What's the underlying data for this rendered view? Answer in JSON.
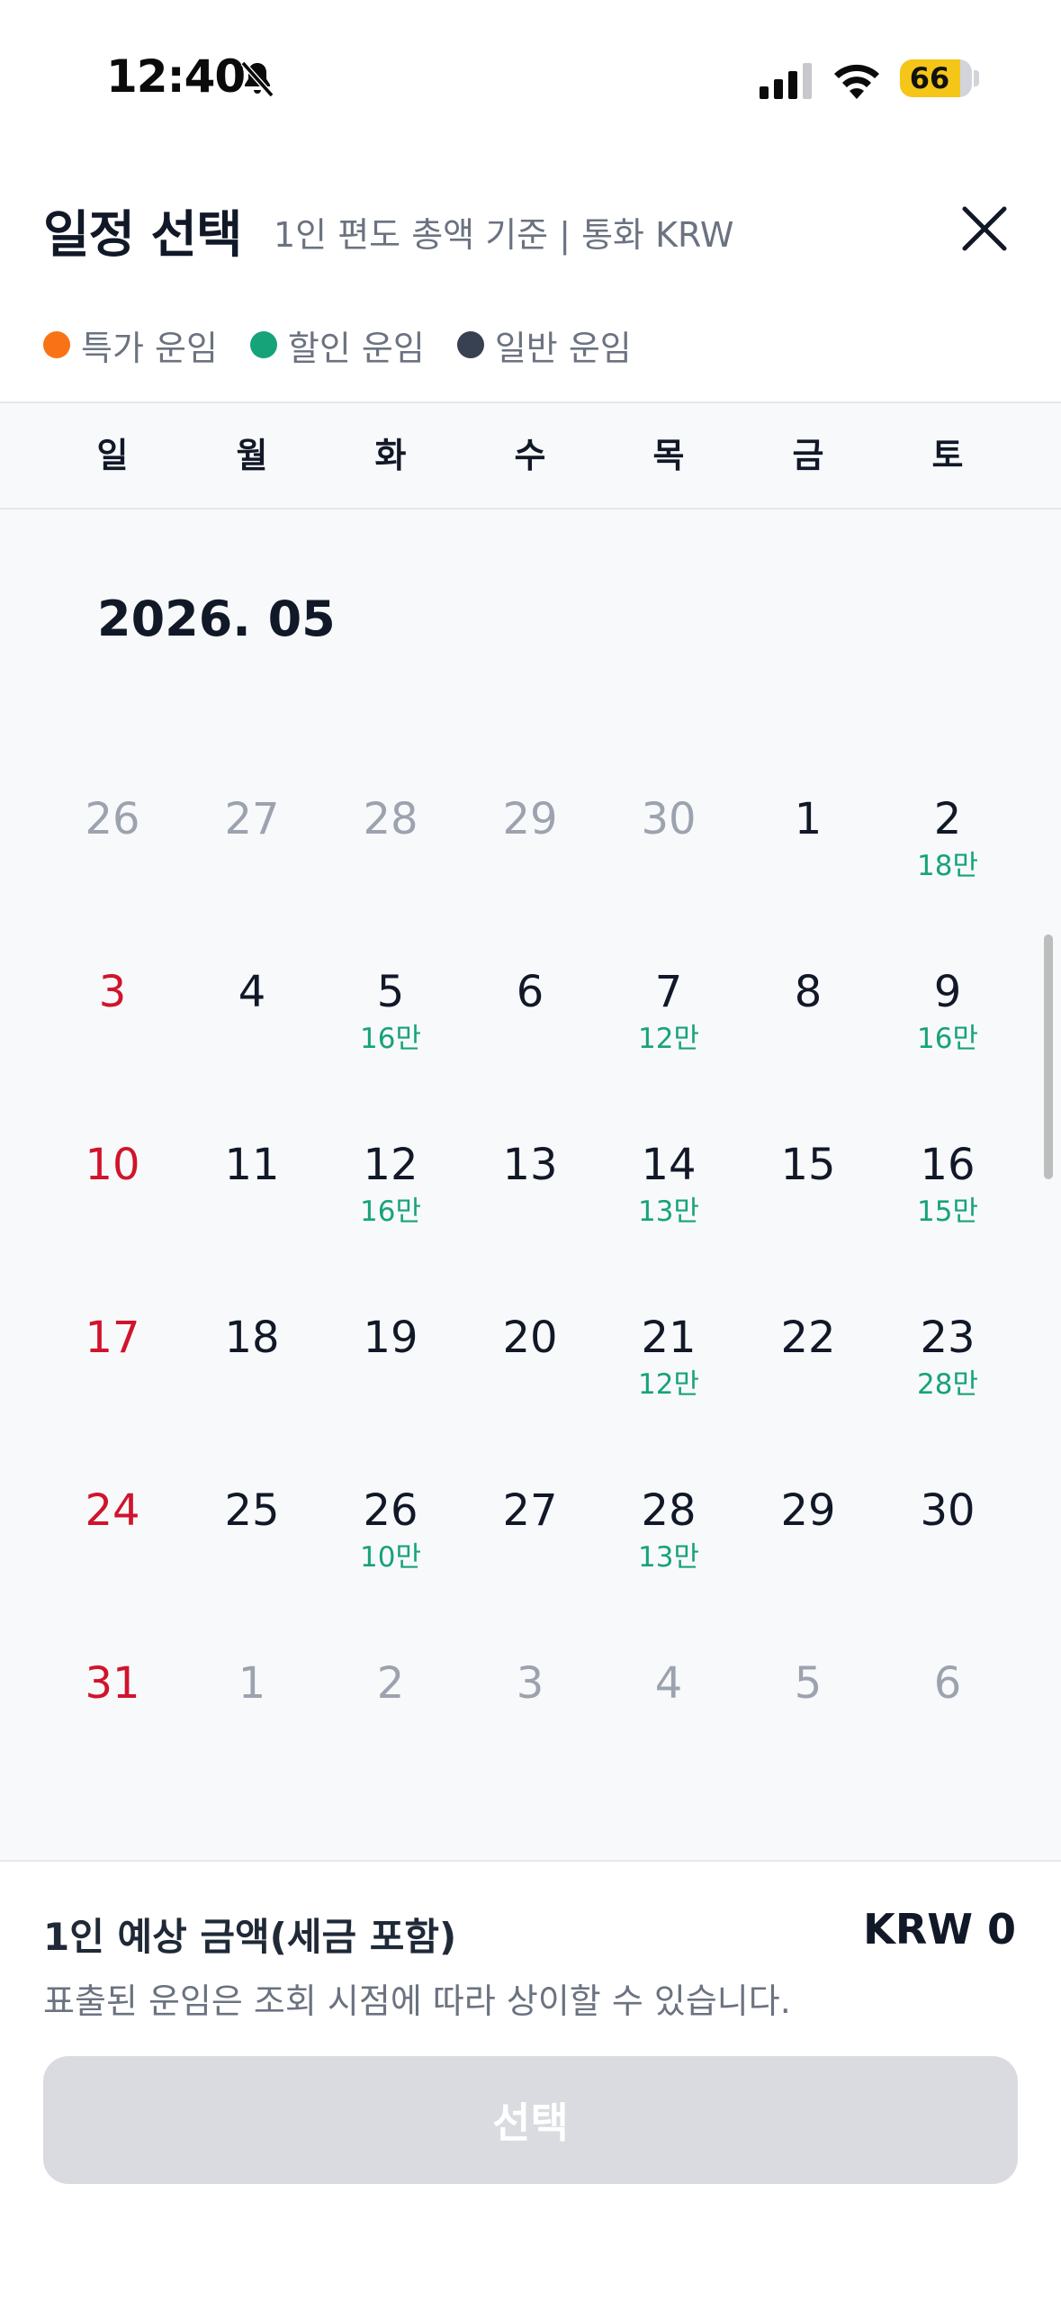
{
  "status_bar": {
    "time": "12:40",
    "battery": "66"
  },
  "header": {
    "title": "일정 선택",
    "subtitle": "1인 편도 총액 기준 | 통화 KRW"
  },
  "legend": [
    {
      "label": "특가 운임",
      "color": "#f97316"
    },
    {
      "label": "할인 운임",
      "color": "#16a37a"
    },
    {
      "label": "일반 운임",
      "color": "#374151"
    }
  ],
  "weekdays": [
    "일",
    "월",
    "화",
    "수",
    "목",
    "금",
    "토"
  ],
  "calendar": {
    "month_label": "2026. 05",
    "weeks": [
      [
        {
          "day": "26",
          "price": "",
          "outside": true
        },
        {
          "day": "27",
          "price": "",
          "outside": true
        },
        {
          "day": "28",
          "price": "",
          "outside": true
        },
        {
          "day": "29",
          "price": "",
          "outside": true
        },
        {
          "day": "30",
          "price": "",
          "outside": true
        },
        {
          "day": "1",
          "price": "",
          "outside": false
        },
        {
          "day": "2",
          "price": "18만",
          "outside": false
        }
      ],
      [
        {
          "day": "3",
          "price": "",
          "outside": false
        },
        {
          "day": "4",
          "price": "",
          "outside": false
        },
        {
          "day": "5",
          "price": "16만",
          "outside": false
        },
        {
          "day": "6",
          "price": "",
          "outside": false
        },
        {
          "day": "7",
          "price": "12만",
          "outside": false
        },
        {
          "day": "8",
          "price": "",
          "outside": false
        },
        {
          "day": "9",
          "price": "16만",
          "outside": false
        }
      ],
      [
        {
          "day": "10",
          "price": "",
          "outside": false
        },
        {
          "day": "11",
          "price": "",
          "outside": false
        },
        {
          "day": "12",
          "price": "16만",
          "outside": false
        },
        {
          "day": "13",
          "price": "",
          "outside": false
        },
        {
          "day": "14",
          "price": "13만",
          "outside": false
        },
        {
          "day": "15",
          "price": "",
          "outside": false
        },
        {
          "day": "16",
          "price": "15만",
          "outside": false
        }
      ],
      [
        {
          "day": "17",
          "price": "",
          "outside": false
        },
        {
          "day": "18",
          "price": "",
          "outside": false
        },
        {
          "day": "19",
          "price": "",
          "outside": false
        },
        {
          "day": "20",
          "price": "",
          "outside": false
        },
        {
          "day": "21",
          "price": "12만",
          "outside": false
        },
        {
          "day": "22",
          "price": "",
          "outside": false
        },
        {
          "day": "23",
          "price": "28만",
          "outside": false
        }
      ],
      [
        {
          "day": "24",
          "price": "",
          "outside": false
        },
        {
          "day": "25",
          "price": "",
          "outside": false
        },
        {
          "day": "26",
          "price": "10만",
          "outside": false
        },
        {
          "day": "27",
          "price": "",
          "outside": false
        },
        {
          "day": "28",
          "price": "13만",
          "outside": false
        },
        {
          "day": "29",
          "price": "",
          "outside": false
        },
        {
          "day": "30",
          "price": "",
          "outside": false
        }
      ],
      [
        {
          "day": "31",
          "price": "",
          "outside": false
        },
        {
          "day": "1",
          "price": "",
          "outside": true
        },
        {
          "day": "2",
          "price": "",
          "outside": true
        },
        {
          "day": "3",
          "price": "",
          "outside": true
        },
        {
          "day": "4",
          "price": "",
          "outside": true
        },
        {
          "day": "5",
          "price": "",
          "outside": true
        },
        {
          "day": "6",
          "price": "",
          "outside": true
        }
      ]
    ]
  },
  "footer": {
    "estimate_label": "1인 예상 금액(세금 포함)",
    "estimate_amount": "KRW 0",
    "notice": "표출된 운임은 조회 시점에 따라 상이할 수 있습니다.",
    "select_label": "선택"
  },
  "colors": {
    "sunday": "#d0142c",
    "price": "#16a37a",
    "disabled_button": "#d9dbe0"
  }
}
